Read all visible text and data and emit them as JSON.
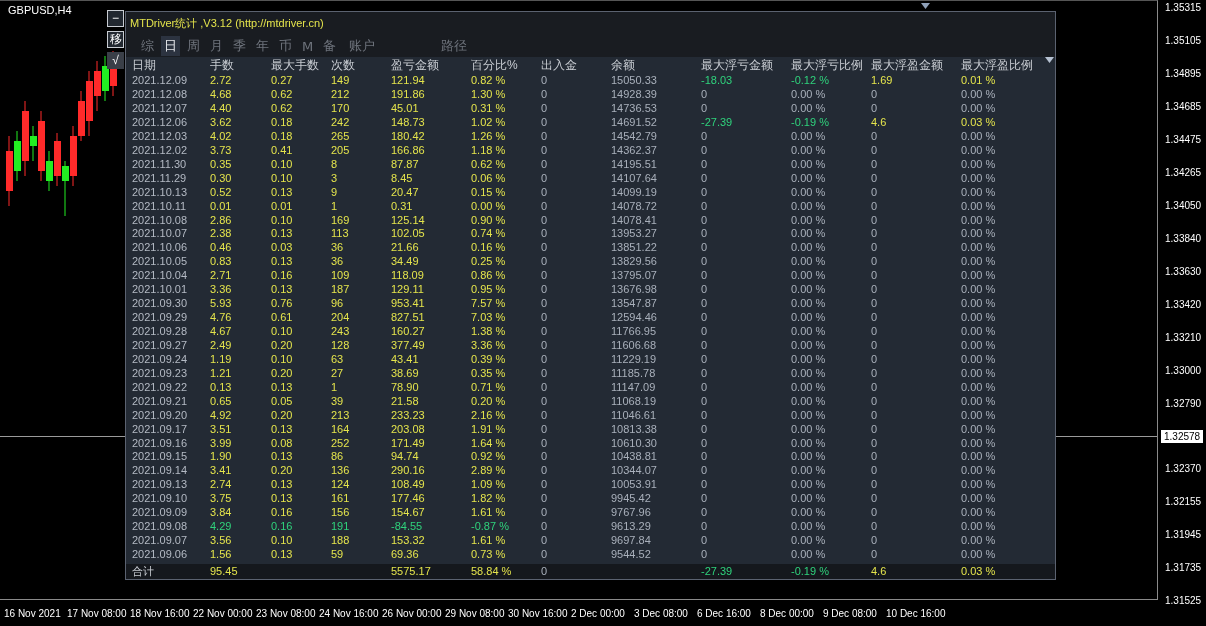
{
  "chart": {
    "symbol": "GBPUSD,H4",
    "price_labels": [
      "1.35315",
      "1.35105",
      "1.34895",
      "1.34685",
      "1.34475",
      "1.34265",
      "1.34050",
      "1.33840",
      "1.33630",
      "1.33420",
      "1.33210",
      "1.33000",
      "1.32790",
      "1.32370",
      "1.32155",
      "1.31945",
      "1.31735",
      "1.31525"
    ],
    "current_price": "1.32578",
    "time_labels": [
      "16 Nov 2021",
      "17 Nov 08:00",
      "18 Nov 16:00",
      "22 Nov 00:00",
      "23 Nov 08:00",
      "24 Nov 16:00",
      "26 Nov 00:00",
      "29 Nov 08:00",
      "30 Nov 16:00",
      "2 Dec 00:00",
      "3 Dec 08:00",
      "6 Dec 16:00",
      "8 Dec 00:00",
      "9 Dec 08:00",
      "10 Dec 16:00"
    ]
  },
  "side_buttons": [
    {
      "label": "−",
      "kind": "outline"
    },
    {
      "label": "移",
      "kind": "outline"
    },
    {
      "label": "√",
      "kind": "filled"
    }
  ],
  "panel": {
    "title": "MTDriver统计 ,V3.12 (http://mtdriver.cn)",
    "tabs": [
      {
        "label": "综",
        "selected": false
      },
      {
        "label": "日",
        "selected": true
      },
      {
        "label": "周",
        "selected": false
      },
      {
        "label": "月",
        "selected": false
      },
      {
        "label": "季",
        "selected": false
      },
      {
        "label": "年",
        "selected": false
      },
      {
        "label": "币",
        "selected": false
      },
      {
        "label": "M",
        "selected": false
      },
      {
        "label": "备",
        "selected": false
      },
      {
        "label": "账户",
        "selected": false
      },
      {
        "label": "路径",
        "selected": false
      }
    ],
    "columns": [
      "日期",
      "手数",
      "最大手数",
      "次数",
      "盈亏金额",
      "百分比%",
      "出入金",
      "余额",
      "最大浮亏金额",
      "最大浮亏比例",
      "最大浮盈金额",
      "最大浮盈比例"
    ],
    "rows": [
      {
        "cells": [
          "2021.12.09",
          "2.72",
          "0.27",
          "149",
          "121.94",
          "0.82 %",
          "0",
          "15050.33",
          "-18.03",
          "-0.12 %",
          "1.69",
          "0.01 %"
        ],
        "loss": false,
        "float_loss": true,
        "float_profit": true
      },
      {
        "cells": [
          "2021.12.08",
          "4.68",
          "0.62",
          "212",
          "191.86",
          "1.30 %",
          "0",
          "14928.39",
          "0",
          "0.00 %",
          "0",
          "0.00 %"
        ],
        "loss": false,
        "float_loss": false,
        "float_profit": false
      },
      {
        "cells": [
          "2021.12.07",
          "4.40",
          "0.62",
          "170",
          "45.01",
          "0.31 %",
          "0",
          "14736.53",
          "0",
          "0.00 %",
          "0",
          "0.00 %"
        ],
        "loss": false,
        "float_loss": false,
        "float_profit": false
      },
      {
        "cells": [
          "2021.12.06",
          "3.62",
          "0.18",
          "242",
          "148.73",
          "1.02 %",
          "0",
          "14691.52",
          "-27.39",
          "-0.19 %",
          "4.6",
          "0.03 %"
        ],
        "loss": false,
        "float_loss": true,
        "float_profit": true
      },
      {
        "cells": [
          "2021.12.03",
          "4.02",
          "0.18",
          "265",
          "180.42",
          "1.26 %",
          "0",
          "14542.79",
          "0",
          "0.00 %",
          "0",
          "0.00 %"
        ],
        "loss": false,
        "float_loss": false,
        "float_profit": false
      },
      {
        "cells": [
          "2021.12.02",
          "3.73",
          "0.41",
          "205",
          "166.86",
          "1.18 %",
          "0",
          "14362.37",
          "0",
          "0.00 %",
          "0",
          "0.00 %"
        ],
        "loss": false,
        "float_loss": false,
        "float_profit": false
      },
      {
        "cells": [
          "2021.11.30",
          "0.35",
          "0.10",
          "8",
          "87.87",
          "0.62 %",
          "0",
          "14195.51",
          "0",
          "0.00 %",
          "0",
          "0.00 %"
        ],
        "loss": false,
        "float_loss": false,
        "float_profit": false
      },
      {
        "cells": [
          "2021.11.29",
          "0.30",
          "0.10",
          "3",
          "8.45",
          "0.06 %",
          "0",
          "14107.64",
          "0",
          "0.00 %",
          "0",
          "0.00 %"
        ],
        "loss": false,
        "float_loss": false,
        "float_profit": false
      },
      {
        "cells": [
          "2021.10.13",
          "0.52",
          "0.13",
          "9",
          "20.47",
          "0.15 %",
          "0",
          "14099.19",
          "0",
          "0.00 %",
          "0",
          "0.00 %"
        ],
        "loss": false,
        "float_loss": false,
        "float_profit": false
      },
      {
        "cells": [
          "2021.10.11",
          "0.01",
          "0.01",
          "1",
          "0.31",
          "0.00 %",
          "0",
          "14078.72",
          "0",
          "0.00 %",
          "0",
          "0.00 %"
        ],
        "loss": false,
        "float_loss": false,
        "float_profit": false
      },
      {
        "cells": [
          "2021.10.08",
          "2.86",
          "0.10",
          "169",
          "125.14",
          "0.90 %",
          "0",
          "14078.41",
          "0",
          "0.00 %",
          "0",
          "0.00 %"
        ],
        "loss": false,
        "float_loss": false,
        "float_profit": false
      },
      {
        "cells": [
          "2021.10.07",
          "2.38",
          "0.13",
          "113",
          "102.05",
          "0.74 %",
          "0",
          "13953.27",
          "0",
          "0.00 %",
          "0",
          "0.00 %"
        ],
        "loss": false,
        "float_loss": false,
        "float_profit": false
      },
      {
        "cells": [
          "2021.10.06",
          "0.46",
          "0.03",
          "36",
          "21.66",
          "0.16 %",
          "0",
          "13851.22",
          "0",
          "0.00 %",
          "0",
          "0.00 %"
        ],
        "loss": false,
        "float_loss": false,
        "float_profit": false
      },
      {
        "cells": [
          "2021.10.05",
          "0.83",
          "0.13",
          "36",
          "34.49",
          "0.25 %",
          "0",
          "13829.56",
          "0",
          "0.00 %",
          "0",
          "0.00 %"
        ],
        "loss": false,
        "float_loss": false,
        "float_profit": false
      },
      {
        "cells": [
          "2021.10.04",
          "2.71",
          "0.16",
          "109",
          "118.09",
          "0.86 %",
          "0",
          "13795.07",
          "0",
          "0.00 %",
          "0",
          "0.00 %"
        ],
        "loss": false,
        "float_loss": false,
        "float_profit": false
      },
      {
        "cells": [
          "2021.10.01",
          "3.36",
          "0.13",
          "187",
          "129.11",
          "0.95 %",
          "0",
          "13676.98",
          "0",
          "0.00 %",
          "0",
          "0.00 %"
        ],
        "loss": false,
        "float_loss": false,
        "float_profit": false
      },
      {
        "cells": [
          "2021.09.30",
          "5.93",
          "0.76",
          "96",
          "953.41",
          "7.57 %",
          "0",
          "13547.87",
          "0",
          "0.00 %",
          "0",
          "0.00 %"
        ],
        "loss": false,
        "float_loss": false,
        "float_profit": false
      },
      {
        "cells": [
          "2021.09.29",
          "4.76",
          "0.61",
          "204",
          "827.51",
          "7.03 %",
          "0",
          "12594.46",
          "0",
          "0.00 %",
          "0",
          "0.00 %"
        ],
        "loss": false,
        "float_loss": false,
        "float_profit": false
      },
      {
        "cells": [
          "2021.09.28",
          "4.67",
          "0.10",
          "243",
          "160.27",
          "1.38 %",
          "0",
          "11766.95",
          "0",
          "0.00 %",
          "0",
          "0.00 %"
        ],
        "loss": false,
        "float_loss": false,
        "float_profit": false
      },
      {
        "cells": [
          "2021.09.27",
          "2.49",
          "0.20",
          "128",
          "377.49",
          "3.36 %",
          "0",
          "11606.68",
          "0",
          "0.00 %",
          "0",
          "0.00 %"
        ],
        "loss": false,
        "float_loss": false,
        "float_profit": false
      },
      {
        "cells": [
          "2021.09.24",
          "1.19",
          "0.10",
          "63",
          "43.41",
          "0.39 %",
          "0",
          "11229.19",
          "0",
          "0.00 %",
          "0",
          "0.00 %"
        ],
        "loss": false,
        "float_loss": false,
        "float_profit": false
      },
      {
        "cells": [
          "2021.09.23",
          "1.21",
          "0.20",
          "27",
          "38.69",
          "0.35 %",
          "0",
          "11185.78",
          "0",
          "0.00 %",
          "0",
          "0.00 %"
        ],
        "loss": false,
        "float_loss": false,
        "float_profit": false
      },
      {
        "cells": [
          "2021.09.22",
          "0.13",
          "0.13",
          "1",
          "78.90",
          "0.71 %",
          "0",
          "11147.09",
          "0",
          "0.00 %",
          "0",
          "0.00 %"
        ],
        "loss": false,
        "float_loss": false,
        "float_profit": false
      },
      {
        "cells": [
          "2021.09.21",
          "0.65",
          "0.05",
          "39",
          "21.58",
          "0.20 %",
          "0",
          "11068.19",
          "0",
          "0.00 %",
          "0",
          "0.00 %"
        ],
        "loss": false,
        "float_loss": false,
        "float_profit": false
      },
      {
        "cells": [
          "2021.09.20",
          "4.92",
          "0.20",
          "213",
          "233.23",
          "2.16 %",
          "0",
          "11046.61",
          "0",
          "0.00 %",
          "0",
          "0.00 %"
        ],
        "loss": false,
        "float_loss": false,
        "float_profit": false
      },
      {
        "cells": [
          "2021.09.17",
          "3.51",
          "0.13",
          "164",
          "203.08",
          "1.91 %",
          "0",
          "10813.38",
          "0",
          "0.00 %",
          "0",
          "0.00 %"
        ],
        "loss": false,
        "float_loss": false,
        "float_profit": false
      },
      {
        "cells": [
          "2021.09.16",
          "3.99",
          "0.08",
          "252",
          "171.49",
          "1.64 %",
          "0",
          "10610.30",
          "0",
          "0.00 %",
          "0",
          "0.00 %"
        ],
        "loss": false,
        "float_loss": false,
        "float_profit": false
      },
      {
        "cells": [
          "2021.09.15",
          "1.90",
          "0.13",
          "86",
          "94.74",
          "0.92 %",
          "0",
          "10438.81",
          "0",
          "0.00 %",
          "0",
          "0.00 %"
        ],
        "loss": false,
        "float_loss": false,
        "float_profit": false
      },
      {
        "cells": [
          "2021.09.14",
          "3.41",
          "0.20",
          "136",
          "290.16",
          "2.89 %",
          "0",
          "10344.07",
          "0",
          "0.00 %",
          "0",
          "0.00 %"
        ],
        "loss": false,
        "float_loss": false,
        "float_profit": false
      },
      {
        "cells": [
          "2021.09.13",
          "2.74",
          "0.13",
          "124",
          "108.49",
          "1.09 %",
          "0",
          "10053.91",
          "0",
          "0.00 %",
          "0",
          "0.00 %"
        ],
        "loss": false,
        "float_loss": false,
        "float_profit": false
      },
      {
        "cells": [
          "2021.09.10",
          "3.75",
          "0.13",
          "161",
          "177.46",
          "1.82 %",
          "0",
          "9945.42",
          "0",
          "0.00 %",
          "0",
          "0.00 %"
        ],
        "loss": false,
        "float_loss": false,
        "float_profit": false
      },
      {
        "cells": [
          "2021.09.09",
          "3.84",
          "0.16",
          "156",
          "154.67",
          "1.61 %",
          "0",
          "9767.96",
          "0",
          "0.00 %",
          "0",
          "0.00 %"
        ],
        "loss": false,
        "float_loss": false,
        "float_profit": false
      },
      {
        "cells": [
          "2021.09.08",
          "4.29",
          "0.16",
          "191",
          "-84.55",
          "-0.87 %",
          "0",
          "9613.29",
          "0",
          "0.00 %",
          "0",
          "0.00 %"
        ],
        "loss": true,
        "float_loss": false,
        "float_profit": false
      },
      {
        "cells": [
          "2021.09.07",
          "3.56",
          "0.10",
          "188",
          "153.32",
          "1.61 %",
          "0",
          "9697.84",
          "0",
          "0.00 %",
          "0",
          "0.00 %"
        ],
        "loss": false,
        "float_loss": false,
        "float_profit": false
      },
      {
        "cells": [
          "2021.09.06",
          "1.56",
          "0.13",
          "59",
          "69.36",
          "0.73 %",
          "0",
          "9544.52",
          "0",
          "0.00 %",
          "0",
          "0.00 %"
        ],
        "loss": false,
        "float_loss": false,
        "float_profit": false
      }
    ],
    "total": {
      "label": "合计",
      "lots": "95.45",
      "pnl": "5575.17",
      "percent": "58.84 %",
      "deposit": "0",
      "max_float_loss": "-27.39",
      "max_float_loss_pct": "-0.19 %",
      "max_float_profit": "4.6",
      "max_float_profit_pct": "0.03 %"
    }
  }
}
